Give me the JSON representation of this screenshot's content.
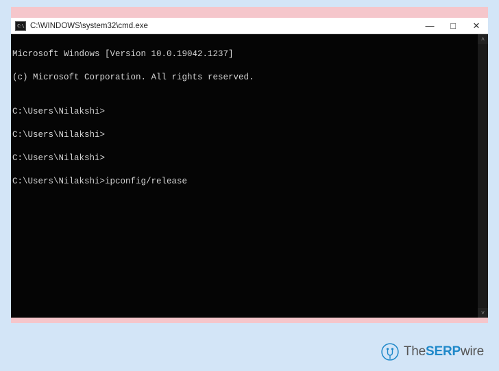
{
  "window": {
    "icon_label": "C:\\",
    "title": "C:\\WINDOWS\\system32\\cmd.exe",
    "controls": {
      "minimize": "—",
      "maximize": "□",
      "close": "✕"
    }
  },
  "terminal": {
    "lines": [
      "Microsoft Windows [Version 10.0.19042.1237]",
      "(c) Microsoft Corporation. All rights reserved.",
      "",
      "C:\\Users\\Nilakshi>",
      "C:\\Users\\Nilakshi>",
      "C:\\Users\\Nilakshi>",
      "C:\\Users\\Nilakshi>ipconfig/release"
    ]
  },
  "scrollbar": {
    "up": "˄",
    "down": "˅"
  },
  "watermark": {
    "pre": "The",
    "mid": "SERP",
    "post": "wire"
  }
}
